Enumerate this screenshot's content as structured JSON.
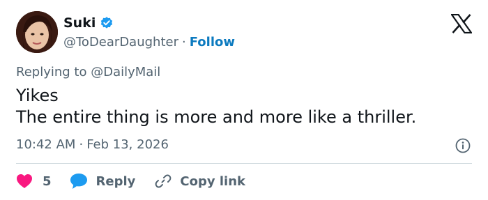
{
  "author": {
    "name": "Suki",
    "handle": "@ToDearDaughter",
    "separator": "·",
    "follow_label": "Follow",
    "verified": true
  },
  "reply": {
    "prefix": "Replying to ",
    "mention": "@DailyMail"
  },
  "tweet": {
    "text": "Yikes\nThe entire thing is more and more like a thriller.",
    "time": "10:42 AM",
    "separator": "·",
    "date": "Feb 13, 2026"
  },
  "actions": {
    "likes_count": "5",
    "reply_label": "Reply",
    "copy_link_label": "Copy link"
  },
  "colors": {
    "accent": "#1d9bf0",
    "follow": "#0c7abf",
    "heart": "#f91880",
    "muted": "#536471",
    "text": "#0f1419",
    "divider": "#cfd9de"
  },
  "icons": {
    "logo": "x-logo-icon",
    "verified": "verified-badge-icon",
    "info": "info-icon",
    "like": "heart-icon",
    "reply": "speech-bubble-icon",
    "copy": "link-icon"
  }
}
